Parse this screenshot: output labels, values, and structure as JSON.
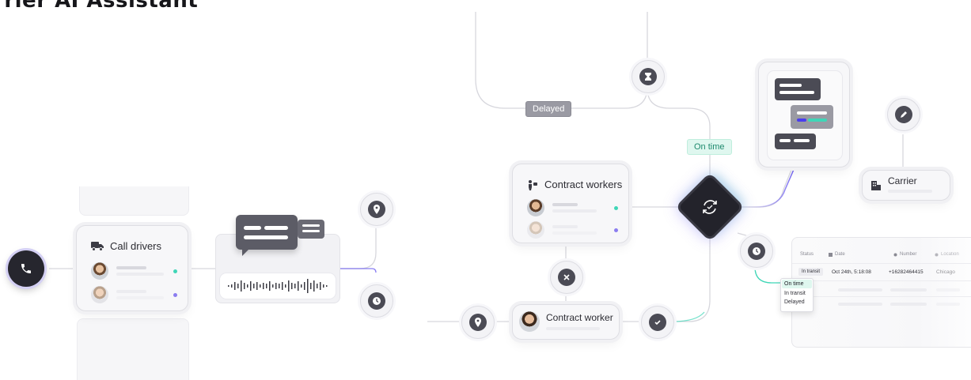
{
  "header": {
    "title": "rrier AI Assistant"
  },
  "flow": {
    "delayed_label": "Delayed",
    "on_time_label": "On time",
    "call_drivers_title": "Call drivers",
    "contract_workers_title": "Contract workers",
    "contract_worker_title": "Contract worker",
    "carrier_title": "Carrier"
  },
  "table": {
    "headers": [
      "Status",
      "Date",
      "Number",
      "Location"
    ],
    "row": {
      "status": "In transit",
      "date": "Oct 24th, 5:18:08",
      "number": "+16282464415",
      "location": "Chicago"
    },
    "dropdown": [
      "On time",
      "In transit",
      "Delayed"
    ],
    "selected": "On time"
  },
  "colors": {
    "accent_teal": "#3fd6b7",
    "accent_purple": "#8b7df0",
    "dark": "#2a2a33"
  },
  "icons": [
    "phone-icon",
    "truck-icon",
    "worker-icon",
    "hourglass-icon",
    "location-pin-icon",
    "clock-icon",
    "close-icon",
    "check-icon",
    "sync-icon",
    "pen-icon",
    "building-icon",
    "calendar-icon",
    "waveform-icon",
    "chat-bubbles-icon"
  ]
}
